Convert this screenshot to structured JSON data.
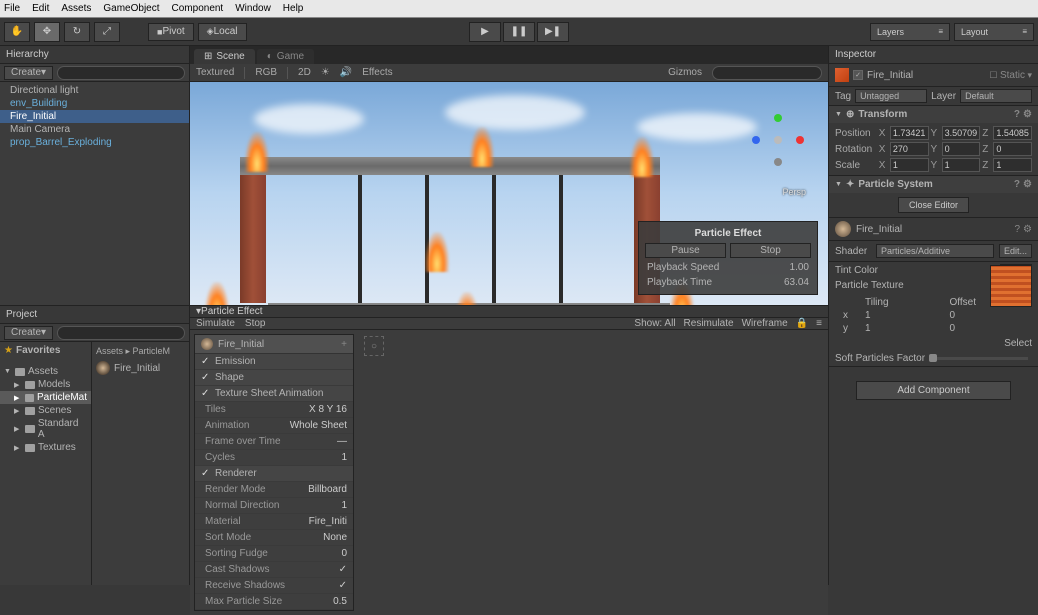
{
  "menu": [
    "File",
    "Edit",
    "Assets",
    "GameObject",
    "Component",
    "Window",
    "Help"
  ],
  "pivot_label": "Pivot",
  "local_label": "Local",
  "layers_label": "Layers",
  "layout_label": "Layout",
  "hierarchy": {
    "title": "Hierarchy",
    "create": "Create",
    "items": [
      {
        "name": "Directional light",
        "blue": false,
        "sel": false
      },
      {
        "name": "env_Building",
        "blue": true,
        "sel": false
      },
      {
        "name": "Fire_Initial",
        "blue": false,
        "sel": true
      },
      {
        "name": "Main Camera",
        "blue": false,
        "sel": false
      },
      {
        "name": "prop_Barrel_Exploding",
        "blue": true,
        "sel": false
      }
    ]
  },
  "project": {
    "title": "Project",
    "create": "Create",
    "favorites": "Favorites",
    "tree": [
      {
        "name": "Assets",
        "depth": 0,
        "open": true,
        "sel": false
      },
      {
        "name": "Models",
        "depth": 1,
        "open": false,
        "sel": false
      },
      {
        "name": "ParticleMat",
        "depth": 1,
        "open": false,
        "sel": true
      },
      {
        "name": "Scenes",
        "depth": 1,
        "open": false,
        "sel": false
      },
      {
        "name": "Standard A",
        "depth": 1,
        "open": false,
        "sel": false
      },
      {
        "name": "Textures",
        "depth": 1,
        "open": false,
        "sel": false
      }
    ],
    "breadcrumb": "Assets ▸ ParticleM",
    "asset": "Fire_Initial"
  },
  "scene": {
    "tab_scene": "Scene",
    "tab_game": "Game",
    "toolbar": [
      "Textured",
      "RGB",
      "2D",
      "Effects",
      "Gizmos"
    ],
    "persp": "Persp"
  },
  "particle_overlay": {
    "title": "Particle Effect",
    "pause": "Pause",
    "stop": "Stop",
    "rows": [
      {
        "k": "Playback Speed",
        "v": "1.00"
      },
      {
        "k": "Playback Time",
        "v": "63.04"
      }
    ]
  },
  "particle_panel": {
    "title": "Particle Effect",
    "simulate": "Simulate",
    "stop": "Stop",
    "show": "Show: All",
    "resimulate": "Resimulate",
    "wireframe": "Wireframe",
    "system_name": "Fire_Initial",
    "modules": [
      {
        "label": "Emission",
        "on": true,
        "sub": []
      },
      {
        "label": "Shape",
        "on": true,
        "sub": []
      },
      {
        "label": "Texture Sheet Animation",
        "on": true,
        "sub": [
          {
            "k": "Tiles",
            "v": "X 8     Y 16"
          },
          {
            "k": "Animation",
            "v": "Whole Sheet"
          },
          {
            "k": "Frame over Time",
            "v": "—"
          },
          {
            "k": "Cycles",
            "v": "1"
          }
        ]
      },
      {
        "label": "Renderer",
        "on": true,
        "sub": [
          {
            "k": "Render Mode",
            "v": "Billboard"
          },
          {
            "k": "Normal Direction",
            "v": "1"
          },
          {
            "k": "Material",
            "v": "Fire_Initi"
          },
          {
            "k": "Sort Mode",
            "v": "None"
          },
          {
            "k": "Sorting Fudge",
            "v": "0"
          },
          {
            "k": "Cast Shadows",
            "v": "✓"
          },
          {
            "k": "Receive Shadows",
            "v": "✓"
          },
          {
            "k": "Max Particle Size",
            "v": "0.5"
          }
        ]
      }
    ]
  },
  "inspector": {
    "title": "Inspector",
    "name": "Fire_Initial",
    "static": "Static",
    "tag": "Tag",
    "untagged": "Untagged",
    "layer": "Layer",
    "default": "Default",
    "transform": "Transform",
    "pos": {
      "lbl": "Position",
      "x": "1.73421",
      "y": "3.50709",
      "z": "1.54085"
    },
    "rot": {
      "lbl": "Rotation",
      "x": "270",
      "y": "0",
      "z": "0"
    },
    "scl": {
      "lbl": "Scale",
      "x": "1",
      "y": "1",
      "z": "1"
    },
    "ps_title": "Particle System",
    "close_editor": "Close Editor",
    "mat_name": "Fire_Initial",
    "shader_lbl": "Shader",
    "shader_val": "Particles/Additive",
    "edit": "Edit...",
    "tint": "Tint Color",
    "ptex": "Particle Texture",
    "tiling": "Tiling",
    "offset": "Offset",
    "t_x": "x",
    "t_y": "y",
    "t_xv": "1",
    "t_yv": "1",
    "o_xv": "0",
    "o_yv": "0",
    "select": "Select",
    "soft": "Soft Particles Factor",
    "add": "Add Component"
  }
}
